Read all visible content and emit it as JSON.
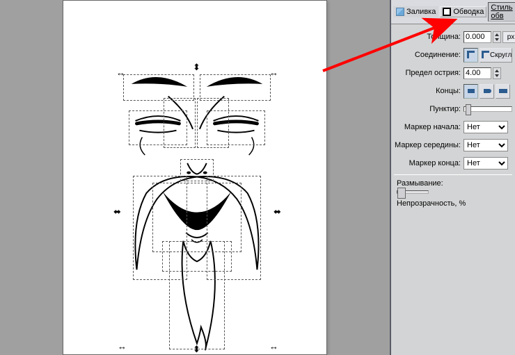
{
  "tabs": {
    "fill": "Заливка",
    "stroke": "Обводка",
    "style": "Стиль обв"
  },
  "labels": {
    "width": "Толщина:",
    "join": "Соединение:",
    "miter": "Предел острия:",
    "caps": "Концы:",
    "dash": "Пунктир:",
    "marker_start": "Маркер начала:",
    "marker_mid": "Маркер середины:",
    "marker_end": "Маркер конца:",
    "blur": "Размывание:",
    "opacity": "Непрозрачность, %"
  },
  "values": {
    "width": "0.000",
    "width_unit": "px",
    "miter": "4.00",
    "join_round_label": "Скругл",
    "marker_none": "Нет"
  }
}
